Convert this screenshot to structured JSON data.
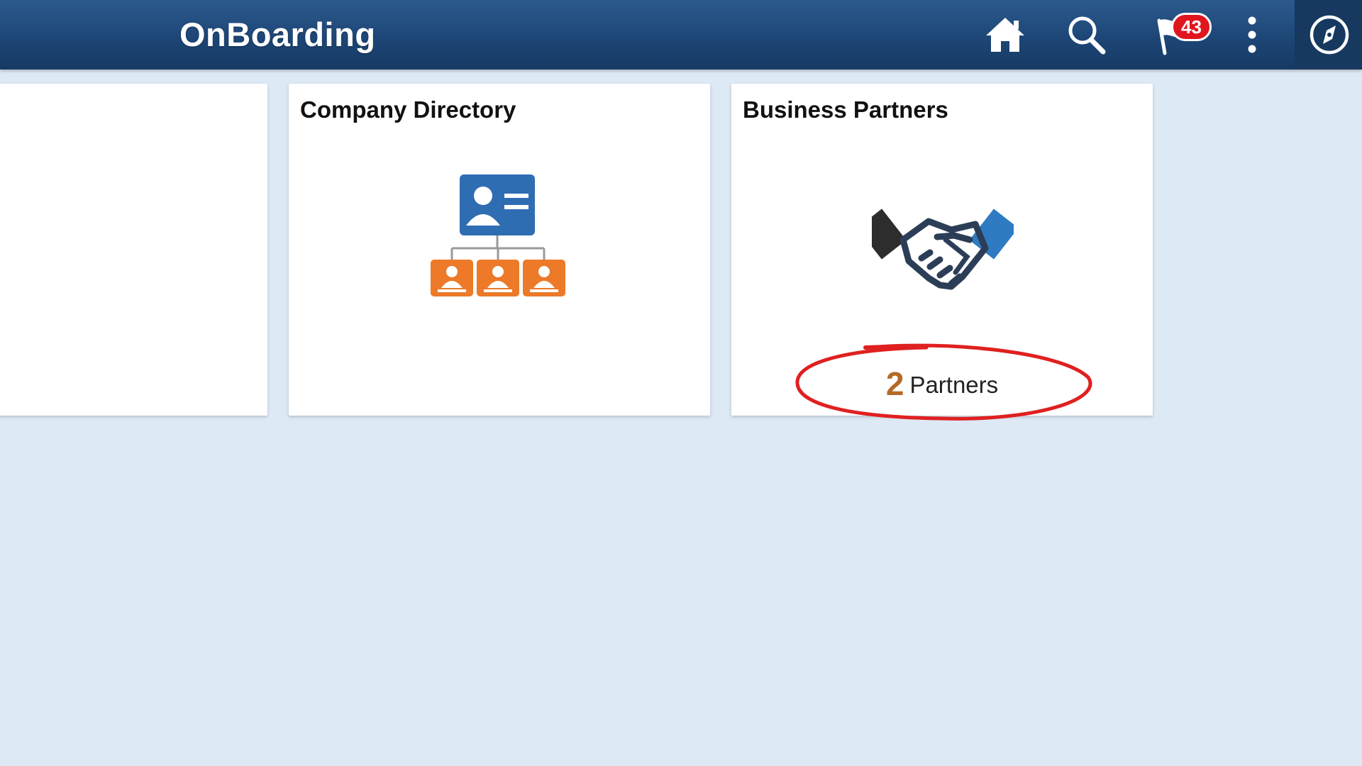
{
  "header": {
    "title": "OnBoarding",
    "icons": [
      "home-icon",
      "search-icon",
      "notifications-flag-icon",
      "actions-menu-icon",
      "navbar-compass-icon"
    ],
    "notification_count": "43"
  },
  "tiles": [
    {
      "title": "",
      "icon": "blank"
    },
    {
      "title": "Company Directory",
      "icon": "org-chart-icon"
    },
    {
      "title": "Business Partners",
      "icon": "handshake-icon",
      "count": "2",
      "count_label": "Partners"
    }
  ],
  "colors": {
    "header": "#1d4676",
    "background": "#dde9f5",
    "badge": "#e0161f",
    "count": "#b46a25",
    "annotation": "#e02020",
    "org_blue": "#2f6db3",
    "org_orange": "#ec7a28"
  }
}
